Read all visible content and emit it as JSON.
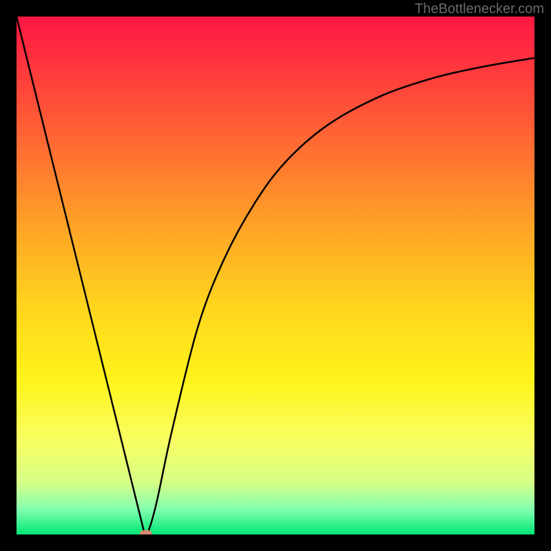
{
  "watermark": "TheBottlenecker.com",
  "chart_data": {
    "type": "line",
    "title": "",
    "xlabel": "",
    "ylabel": "",
    "xlim": [
      0,
      100
    ],
    "ylim": [
      0,
      100
    ],
    "gradient_stops": [
      {
        "offset": 0.0,
        "color": "#ff1744"
      },
      {
        "offset": 0.06,
        "color": "#ff2a3f"
      },
      {
        "offset": 0.2,
        "color": "#ff5a36"
      },
      {
        "offset": 0.38,
        "color": "#ff9a28"
      },
      {
        "offset": 0.55,
        "color": "#ffd21e"
      },
      {
        "offset": 0.7,
        "color": "#fff31a"
      },
      {
        "offset": 0.82,
        "color": "#f8ff63"
      },
      {
        "offset": 0.9,
        "color": "#d6ff86"
      },
      {
        "offset": 0.95,
        "color": "#86ffb0"
      },
      {
        "offset": 1.0,
        "color": "#00e676"
      }
    ],
    "series": [
      {
        "name": "bottleneck-curve",
        "points": [
          [
            0,
            100
          ],
          [
            24.7,
            0.2
          ],
          [
            25.3,
            0.2
          ],
          [
            27,
            6
          ],
          [
            30,
            20
          ],
          [
            35,
            40
          ],
          [
            40,
            53
          ],
          [
            46,
            64
          ],
          [
            52,
            72
          ],
          [
            60,
            79
          ],
          [
            70,
            84.5
          ],
          [
            80,
            88
          ],
          [
            90,
            90.3
          ],
          [
            100,
            92
          ]
        ]
      }
    ],
    "marker": {
      "x": 25,
      "y": 0.2,
      "color": "#d88a6e"
    }
  }
}
